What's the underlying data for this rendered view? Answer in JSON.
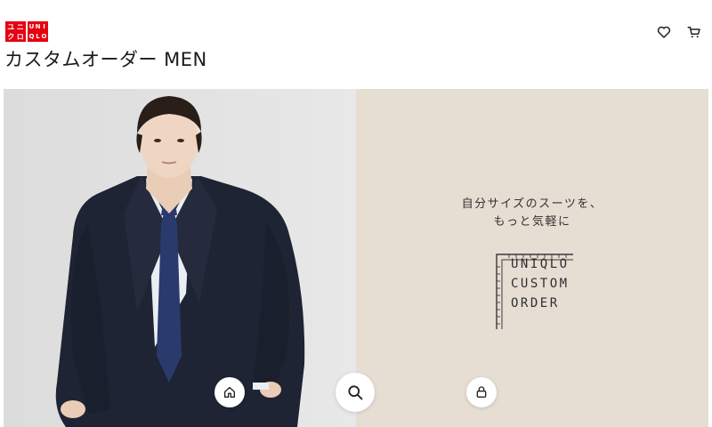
{
  "brand": {
    "logo_katakana": [
      "ユ",
      "ニ",
      "ク",
      "ロ"
    ],
    "logo_latin": [
      "U",
      "N",
      "I",
      "Q",
      "L",
      "O"
    ],
    "color": "#e60012"
  },
  "header": {
    "title": "カスタムオーダー MEN",
    "icons": {
      "favorites": "heart-icon",
      "cart": "cart-icon"
    }
  },
  "hero": {
    "left_bg": "#e4e4e4",
    "right_bg": "#e6ddd3",
    "tagline": [
      "自分サイズのスーツを、",
      "もっと気軽に"
    ],
    "custom_order_logo": [
      "UNIQLO",
      "CUSTOM",
      "ORDER"
    ]
  },
  "bottom_nav": {
    "icons": [
      "home-icon",
      "search-icon",
      "account-icon"
    ]
  }
}
